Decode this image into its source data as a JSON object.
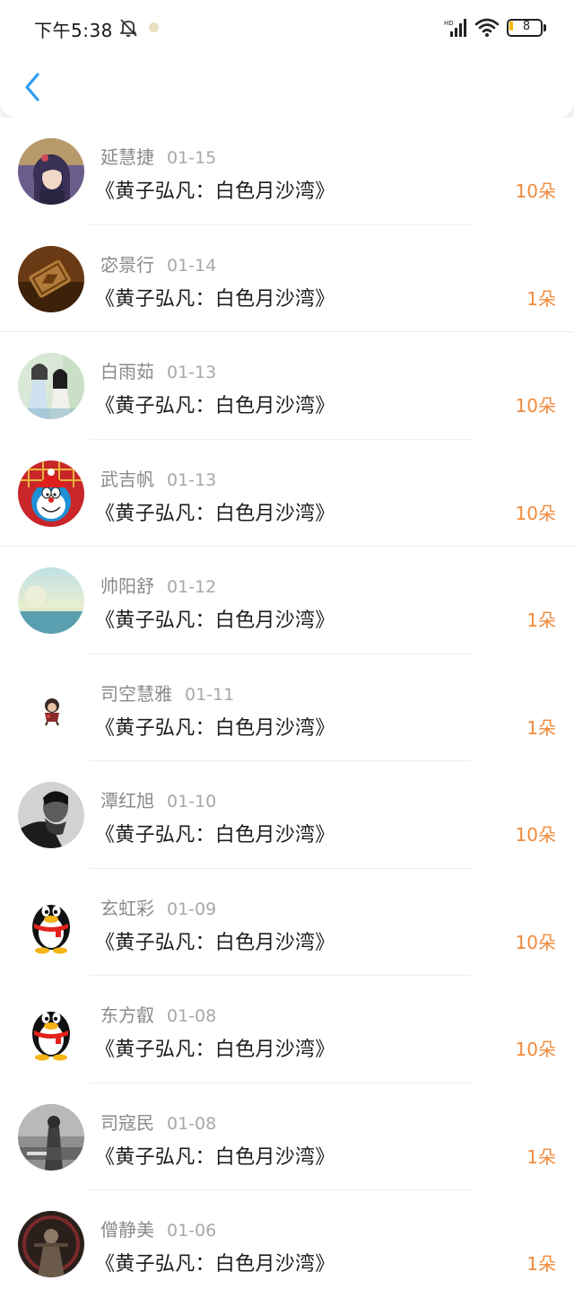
{
  "status_bar": {
    "time": "下午5:38",
    "battery": "8",
    "icons": [
      "mute-bell-icon",
      "signal-hd-icon",
      "wifi-icon",
      "battery-icon"
    ]
  },
  "nav": {
    "back_icon": "chevron-left-icon"
  },
  "colors": {
    "accent_blue": "#2f9bf2",
    "flower_orange": "#f08a3c",
    "name_gray": "#8a8a8a",
    "date_gray": "#a8a8a8",
    "title_dark": "#1c1c1c"
  },
  "gifts": [
    {
      "name": "延慧捷",
      "date": "01-15",
      "book": "《黄子弘凡：白色月沙湾》",
      "amount": "10朵",
      "avatar": "anime-girl-avatar"
    },
    {
      "name": "宓景行",
      "date": "01-14",
      "book": "《黄子弘凡：白色月沙湾》",
      "amount": "1朵",
      "avatar": "stamp-seal-avatar"
    },
    {
      "name": "白雨茹",
      "date": "01-13",
      "book": "《黄子弘凡：白色月沙湾》",
      "amount": "10朵",
      "avatar": "ancient-couple-avatar"
    },
    {
      "name": "武吉帆",
      "date": "01-13",
      "book": "《黄子弘凡：白色月沙湾》",
      "amount": "10朵",
      "avatar": "doraemon-avatar"
    },
    {
      "name": "帅阳舒",
      "date": "01-12",
      "book": "《黄子弘凡：白色月沙湾》",
      "amount": "1朵",
      "avatar": "seascape-avatar"
    },
    {
      "name": "司空慧雅",
      "date": "01-11",
      "book": "《黄子弘凡：白色月沙湾》",
      "amount": "1朵",
      "avatar": "small-doll-avatar"
    },
    {
      "name": "潭红旭",
      "date": "01-10",
      "book": "《黄子弘凡：白色月沙湾》",
      "amount": "10朵",
      "avatar": "bw-portrait-avatar"
    },
    {
      "name": "玄虹彩",
      "date": "01-09",
      "book": "《黄子弘凡：白色月沙湾》",
      "amount": "10朵",
      "avatar": "qq-penguin-avatar"
    },
    {
      "name": "东方叡",
      "date": "01-08",
      "book": "《黄子弘凡：白色月沙湾》",
      "amount": "10朵",
      "avatar": "qq-penguin-avatar"
    },
    {
      "name": "司寇民",
      "date": "01-08",
      "book": "《黄子弘凡：白色月沙湾》",
      "amount": "1朵",
      "avatar": "gray-photo-avatar"
    },
    {
      "name": "僧静美",
      "date": "01-06",
      "book": "《黄子弘凡：白色月沙湾》",
      "amount": "1朵",
      "avatar": "dark-figure-avatar"
    }
  ]
}
